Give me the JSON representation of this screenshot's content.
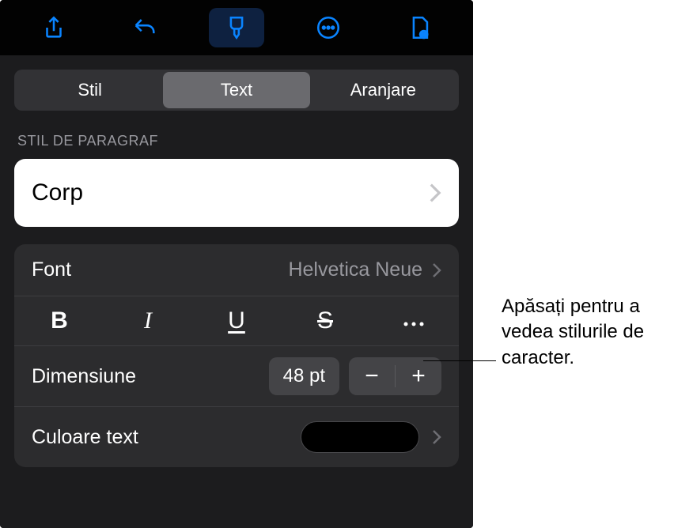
{
  "toolbar": {
    "icons": [
      "share-icon",
      "undo-icon",
      "brush-icon",
      "more-icon",
      "view-icon"
    ]
  },
  "tabs": {
    "items": [
      "Stil",
      "Text",
      "Aranjare"
    ],
    "active": 1
  },
  "section_label": "STIL DE PARAGRAF",
  "paragraph_style": "Corp",
  "font": {
    "label": "Font",
    "value": "Helvetica Neue"
  },
  "format": {
    "bold": "B",
    "italic": "I",
    "underline": "U",
    "strike": "S"
  },
  "size": {
    "label": "Dimensiune",
    "value": "48 pt",
    "minus": "−",
    "plus": "+"
  },
  "color": {
    "label": "Culoare text",
    "value": "#000000"
  },
  "callout": "Apăsați pentru a vedea stilurile de caracter."
}
